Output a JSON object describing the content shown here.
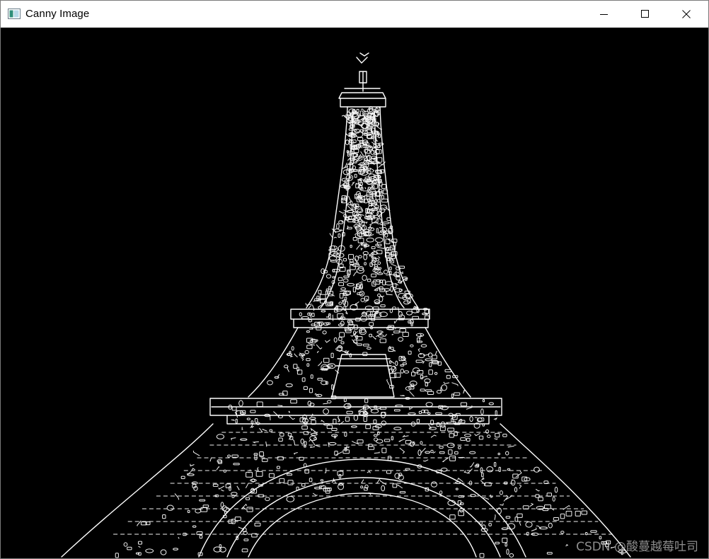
{
  "window": {
    "title": "Canny Image"
  },
  "icons": {
    "app": "opencv-window-icon",
    "minimize": "minimize-icon",
    "maximize": "maximize-icon",
    "close": "close-icon"
  },
  "image": {
    "subject": "eiffel-tower-edge-map",
    "background_color": "#000000",
    "edge_color": "#ffffff"
  },
  "watermark": {
    "text": "CSDN @酸蔓越莓吐司"
  }
}
